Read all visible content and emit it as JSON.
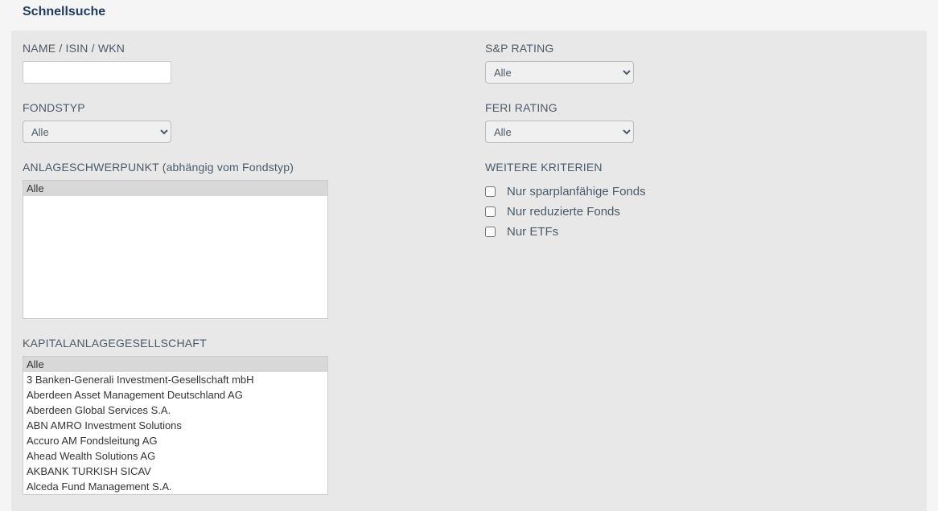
{
  "title": "Schnellsuche",
  "left": {
    "nameLabel": "NAME / ISIN / WKN",
    "nameValue": "",
    "fondstypLabel": "FONDSTYP",
    "fondstypValue": "Alle",
    "anlageschwerpunktLabel": "ANLAGESCHWERPUNKT (abhängig vom Fondstyp)",
    "anlageschwerpunktItems": [
      "Alle"
    ],
    "kagLabel": "KAPITALANLAGEGESELLSCHAFT",
    "kagItems": [
      "Alle",
      "3 Banken-Generali Investment-Gesellschaft mbH",
      "Aberdeen Asset Management Deutschland AG",
      "Aberdeen Global Services S.A.",
      "ABN AMRO Investment Solutions",
      "Accuro AM Fondsleitung AG",
      "Ahead Wealth Solutions AG",
      "AKBANK TURKISH SICAV",
      "Alceda Fund Management S.A."
    ]
  },
  "right": {
    "spRatingLabel": "S&P RATING",
    "spRatingValue": "Alle",
    "feriRatingLabel": "FERI RATING",
    "feriRatingValue": "Alle",
    "weitereLabel": "WEITERE KRITERIEN",
    "criteria": [
      {
        "label": "Nur sparplanfähige Fonds",
        "checked": false
      },
      {
        "label": "Nur reduzierte Fonds",
        "checked": false
      },
      {
        "label": "Nur ETFs",
        "checked": false
      }
    ]
  }
}
